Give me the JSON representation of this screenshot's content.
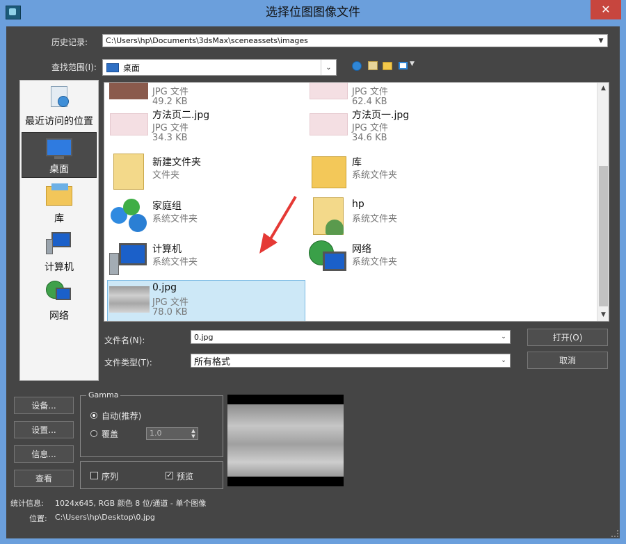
{
  "window": {
    "title": "选择位图图像文件",
    "close_glyph": "✕"
  },
  "history": {
    "label": "历史记录:",
    "value": "C:\\Users\\hp\\Documents\\3dsMax\\sceneassets\\images"
  },
  "lookin": {
    "label": "查找范围(I):",
    "value": "桌面"
  },
  "places": [
    {
      "label": "最近访问的位置",
      "icon": "recent-places-icon"
    },
    {
      "label": "桌面",
      "icon": "desktop-icon",
      "selected": true
    },
    {
      "label": "库",
      "icon": "library-icon"
    },
    {
      "label": "计算机",
      "icon": "computer-icon"
    },
    {
      "label": "网络",
      "icon": "network-icon"
    }
  ],
  "files": [
    {
      "name": "",
      "type": "JPG 文件",
      "size": "49.2 KB"
    },
    {
      "name": "",
      "type": "JPG 文件",
      "size": "62.4 KB"
    },
    {
      "name": "方法页二.jpg",
      "type": "JPG 文件",
      "size": "34.3 KB"
    },
    {
      "name": "方法页一.jpg",
      "type": "JPG 文件",
      "size": "34.6 KB"
    },
    {
      "name": "新建文件夹",
      "type": "文件夹"
    },
    {
      "name": "库",
      "type": "系统文件夹"
    },
    {
      "name": "家庭组",
      "type": "系统文件夹"
    },
    {
      "name": "hp",
      "type": "系统文件夹"
    },
    {
      "name": "计算机",
      "type": "系统文件夹"
    },
    {
      "name": "网络",
      "type": "系统文件夹"
    },
    {
      "name": "0.jpg",
      "type": "JPG 文件",
      "size": "78.0 KB",
      "selected": true
    }
  ],
  "filename": {
    "label": "文件名(N):",
    "value": "0.jpg"
  },
  "filetype": {
    "label": "文件类型(T):",
    "value": "所有格式"
  },
  "buttons": {
    "open": "打开(O)",
    "cancel": "取消",
    "setup1": "设备...",
    "setup2": "设置...",
    "info": "信息...",
    "view": "查看"
  },
  "gamma": {
    "title": "Gamma",
    "auto": "自动(推荐)",
    "override": "覆盖",
    "override_value": "1.0"
  },
  "options": {
    "sequence": "序列",
    "preview": "预览",
    "preview_checked": true
  },
  "stats": {
    "label": "统计信息:",
    "value": "1024x645, RGB 颜色 8 位/通道 - 单个图像"
  },
  "location": {
    "label": "位置:",
    "value": "C:\\Users\\hp\\Desktop\\0.jpg"
  },
  "colors": {
    "accent": "#6b9fdc",
    "panel": "#454545",
    "close": "#c7463e",
    "selection": "#cde8f7",
    "arrow": "#e53935"
  }
}
